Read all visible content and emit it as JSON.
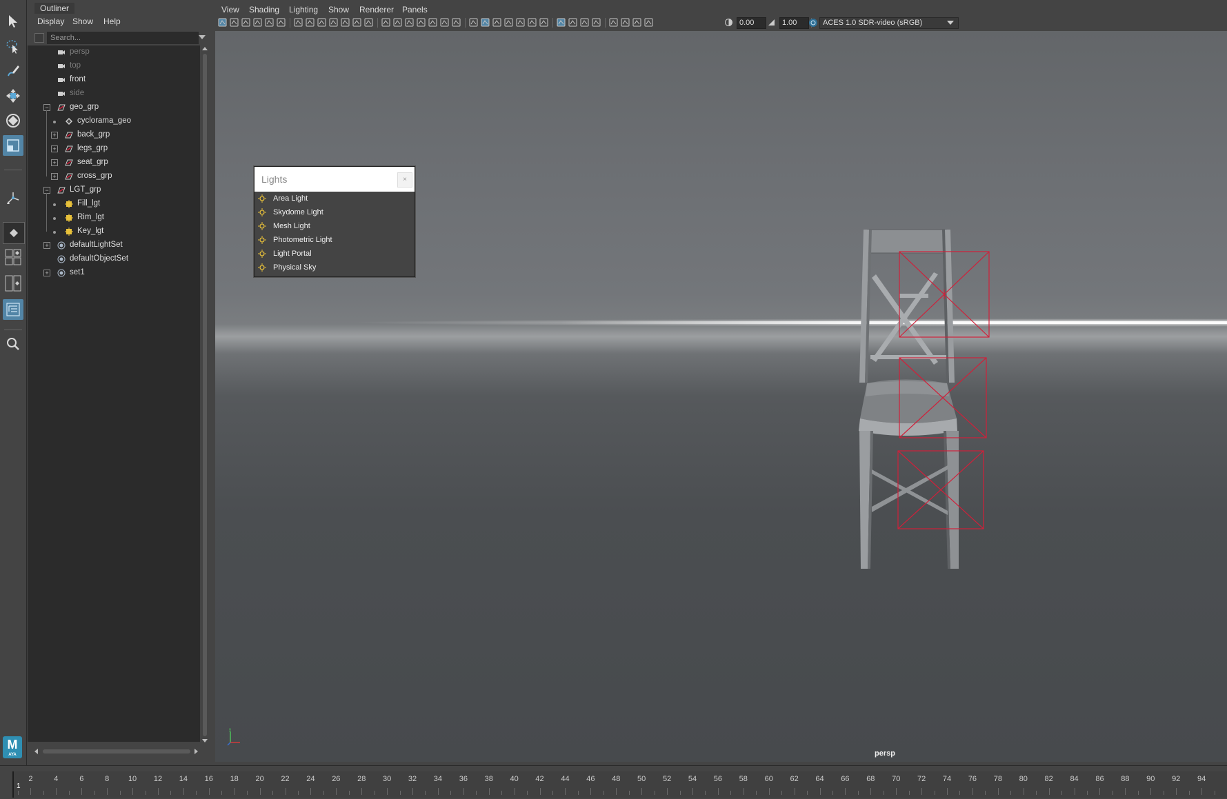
{
  "toolbox": {
    "tools": [
      "select-tool",
      "lasso-select-tool",
      "paint-select-tool",
      "move-tool",
      "rotate-tool",
      "scale-tool",
      "universal-manipulator-tool",
      "soft-mod-tool"
    ],
    "logo": {
      "letter": "M",
      "sub": "AYA"
    }
  },
  "outliner": {
    "title": "Outliner",
    "menu": [
      "Display",
      "Show",
      "Help"
    ],
    "search_placeholder": "Search...",
    "items": [
      {
        "label": "persp",
        "type": "camera",
        "dim": true,
        "depth": 0
      },
      {
        "label": "top",
        "type": "camera",
        "dim": true,
        "depth": 0
      },
      {
        "label": "front",
        "type": "camera",
        "dim": false,
        "depth": 0
      },
      {
        "label": "side",
        "type": "camera",
        "dim": true,
        "depth": 0
      },
      {
        "label": "geo_grp",
        "type": "group",
        "dim": false,
        "depth": 0,
        "expand": "minus"
      },
      {
        "label": "cyclorama_geo",
        "type": "mesh",
        "dim": false,
        "depth": 1
      },
      {
        "label": "back_grp",
        "type": "group",
        "dim": false,
        "depth": 1,
        "expand": "plus"
      },
      {
        "label": "legs_grp",
        "type": "group",
        "dim": false,
        "depth": 1,
        "expand": "plus"
      },
      {
        "label": "seat_grp",
        "type": "group",
        "dim": false,
        "depth": 1,
        "expand": "plus"
      },
      {
        "label": "cross_grp",
        "type": "group",
        "dim": false,
        "depth": 1,
        "expand": "plus"
      },
      {
        "label": "LGT_grp",
        "type": "group",
        "dim": false,
        "depth": 0,
        "expand": "minus"
      },
      {
        "label": "Fill_lgt",
        "type": "light",
        "dim": false,
        "depth": 1
      },
      {
        "label": "Rim_lgt",
        "type": "light",
        "dim": false,
        "depth": 1
      },
      {
        "label": "Key_lgt",
        "type": "light",
        "dim": false,
        "depth": 1
      },
      {
        "label": "defaultLightSet",
        "type": "set",
        "dim": false,
        "depth": 0,
        "expand": "plus"
      },
      {
        "label": "defaultObjectSet",
        "type": "set",
        "dim": false,
        "depth": 0
      },
      {
        "label": "set1",
        "type": "set",
        "dim": false,
        "depth": 0,
        "expand": "plus"
      }
    ]
  },
  "panel": {
    "menu": [
      "View",
      "Shading",
      "Lighting",
      "Show",
      "Renderer",
      "Panels"
    ],
    "exposure": "0.00",
    "gamma": "1.00",
    "color_space": "ACES 1.0 SDR-video (sRGB)",
    "camera_label": "persp"
  },
  "lights_popup": {
    "title": "Lights",
    "close": "×",
    "items": [
      {
        "label": "Area Light",
        "icon": "area-light-icon"
      },
      {
        "label": "Skydome Light",
        "icon": "skydome-light-icon"
      },
      {
        "label": "Mesh Light",
        "icon": "mesh-light-icon"
      },
      {
        "label": "Photometric Light",
        "icon": "photometric-light-icon"
      },
      {
        "label": "Light Portal",
        "icon": "light-portal-icon"
      },
      {
        "label": "Physical Sky",
        "icon": "physical-sky-icon"
      }
    ]
  },
  "timeslider": {
    "current_frame": "1",
    "start": 1,
    "end": 95,
    "labels": [
      "2",
      "4",
      "6",
      "8",
      "10",
      "12",
      "14",
      "16",
      "18",
      "20",
      "22",
      "24",
      "26",
      "28",
      "30",
      "32",
      "34",
      "36",
      "38",
      "40",
      "42",
      "44",
      "46",
      "48",
      "50",
      "52",
      "54",
      "56",
      "58",
      "60",
      "62",
      "64",
      "66",
      "68",
      "70",
      "72",
      "74",
      "76",
      "78",
      "80",
      "82",
      "84",
      "86",
      "88",
      "90",
      "92",
      "94"
    ]
  },
  "colors": {
    "accent": "#5285a6",
    "light_wire": "#d0203a",
    "light_icon": "#e8c13a"
  }
}
